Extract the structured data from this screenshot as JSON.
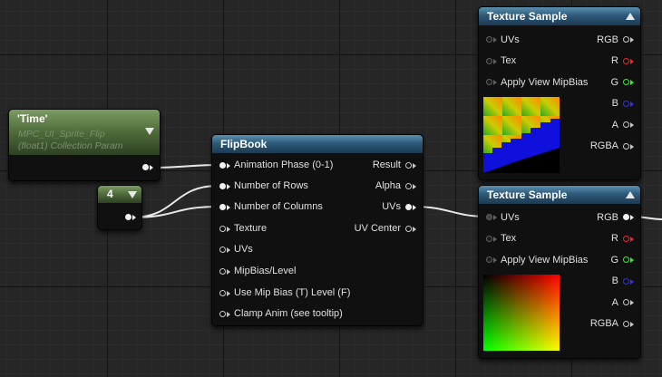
{
  "time_node": {
    "title": "'Time'",
    "subtitle_line1": "MPC_UI_Sprite_Flip",
    "subtitle_line2": "(float1) Collection Param"
  },
  "const_node": {
    "value": "4"
  },
  "flipbook": {
    "title": "FlipBook",
    "inputs": [
      "Animation  Phase (0-1)",
      "Number of Rows",
      "Number of Columns",
      "Texture",
      "UVs",
      "MipBias/Level",
      "Use Mip Bias (T) Level (F)",
      "Clamp Anim (see tooltip)"
    ],
    "outputs": [
      "Result",
      "Alpha",
      "UVs",
      "UV Center"
    ]
  },
  "texture_sample_top": {
    "title": "Texture Sample",
    "inputs": [
      "UVs",
      "Tex",
      "Apply View MipBias"
    ],
    "outputs": [
      "RGB",
      "R",
      "G",
      "B",
      "A",
      "RGBA"
    ]
  },
  "texture_sample_bottom": {
    "title": "Texture Sample",
    "inputs": [
      "UVs",
      "Tex",
      "Apply View MipBias"
    ],
    "outputs": [
      "RGB",
      "R",
      "G",
      "B",
      "A",
      "RGBA"
    ]
  },
  "colors": {
    "header_blue": "#2e5a7a",
    "header_green": "#4e6b3a",
    "pin_r": "#ff2020",
    "pin_g": "#20ff20",
    "pin_b": "#3030ff"
  }
}
